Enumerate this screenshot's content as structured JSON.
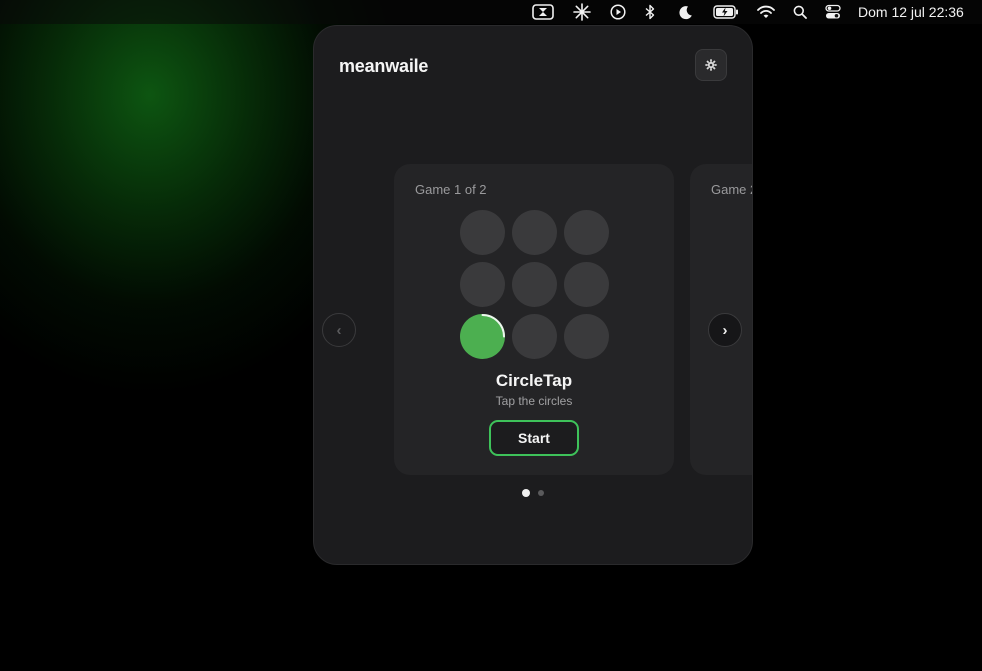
{
  "menubar": {
    "icons": [
      "hourglass-icon",
      "sparkle-icon",
      "play-circle-icon",
      "bluetooth-icon",
      "moon-icon",
      "battery-charging-icon",
      "wifi-icon",
      "search-icon",
      "control-center-icon"
    ],
    "clock": "Dom 12 jul 22:36"
  },
  "app": {
    "brand": "meanwaile",
    "settings_icon": "gear-icon",
    "prev_label": "‹",
    "next_label": "›"
  },
  "cards": [
    {
      "counter": "Game 1 of 2",
      "title": "CircleTap",
      "subtitle": "Tap the circles",
      "button": "Start",
      "grid_active_cell": 6
    },
    {
      "counter": "Game 2"
    }
  ],
  "pagination": {
    "total": 2,
    "current": 1
  },
  "colors": {
    "accent": "#3ec25a",
    "active_circle": "#4caf50",
    "panel": "#1c1c1e",
    "card": "#242426"
  }
}
